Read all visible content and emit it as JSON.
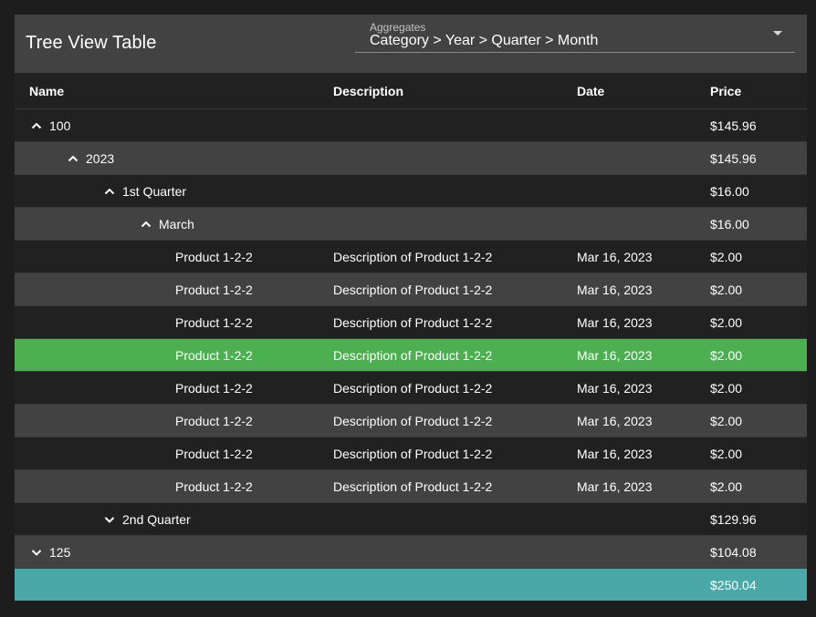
{
  "header": {
    "title": "Tree View Table",
    "aggregates_label": "Aggregates",
    "aggregates_value": "Category > Year > Quarter > Month"
  },
  "columns": {
    "name": "Name",
    "description": "Description",
    "date": "Date",
    "price": "Price"
  },
  "rows": [
    {
      "name": "100",
      "price": "$145.96",
      "expand": "expanded"
    },
    {
      "name": "2023",
      "price": "$145.96",
      "expand": "expanded"
    },
    {
      "name": "1st Quarter",
      "price": "$16.00",
      "expand": "expanded"
    },
    {
      "name": "March",
      "price": "$16.00",
      "expand": "expanded"
    },
    {
      "name": "Product 1-2-2",
      "description": "Description of Product 1-2-2",
      "date": "Mar 16, 2023",
      "price": "$2.00"
    },
    {
      "name": "Product 1-2-2",
      "description": "Description of Product 1-2-2",
      "date": "Mar 16, 2023",
      "price": "$2.00"
    },
    {
      "name": "Product 1-2-2",
      "description": "Description of Product 1-2-2",
      "date": "Mar 16, 2023",
      "price": "$2.00"
    },
    {
      "name": "Product 1-2-2",
      "description": "Description of Product 1-2-2",
      "date": "Mar 16, 2023",
      "price": "$2.00",
      "state": "selected"
    },
    {
      "name": "Product 1-2-2",
      "description": "Description of Product 1-2-2",
      "date": "Mar 16, 2023",
      "price": "$2.00"
    },
    {
      "name": "Product 1-2-2",
      "description": "Description of Product 1-2-2",
      "date": "Mar 16, 2023",
      "price": "$2.00"
    },
    {
      "name": "Product 1-2-2",
      "description": "Description of Product 1-2-2",
      "date": "Mar 16, 2023",
      "price": "$2.00"
    },
    {
      "name": "Product 1-2-2",
      "description": "Description of Product 1-2-2",
      "date": "Mar 16, 2023",
      "price": "$2.00"
    },
    {
      "name": "2nd Quarter",
      "price": "$129.96",
      "expand": "collapsed"
    },
    {
      "name": "125",
      "price": "$104.08",
      "expand": "collapsed"
    }
  ],
  "total": {
    "price": "$250.04"
  },
  "colors": {
    "background": "#1d1d1d",
    "surface": "#212121",
    "stripe": "#424242",
    "selected": "#4caf50",
    "total": "#4aa9a8"
  },
  "icons": {
    "expanded": "chevron-up-icon",
    "collapsed": "chevron-down-icon",
    "dropdown": "caret-down-icon"
  }
}
